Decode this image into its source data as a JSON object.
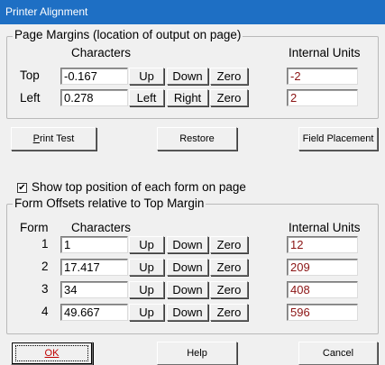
{
  "window": {
    "title": "Printer Alignment"
  },
  "page_margins": {
    "legend": "Page Margins (location of output on page)",
    "characters_header": "Characters",
    "internal_units_header": "Internal Units",
    "rows": [
      {
        "label": "Top",
        "characters": "-0.167",
        "btn1": "Up",
        "btn2": "Down",
        "btn3": "Zero",
        "internal": "-2"
      },
      {
        "label": "Left",
        "characters": "0.278",
        "btn1": "Left",
        "btn2": "Right",
        "btn3": "Zero",
        "internal": "2"
      }
    ]
  },
  "actions": {
    "print_test": "Print Test",
    "print_test_mnemonic": "P",
    "print_test_rest": "rint Test",
    "restore": "Restore",
    "field_placement": "Field Placement"
  },
  "show_top": {
    "label": "Show top position of each form on page",
    "checked": true,
    "mark": "✔"
  },
  "form_offsets": {
    "legend": "Form Offsets relative to Top Margin",
    "form_header": "Form",
    "characters_header": "Characters",
    "internal_units_header": "Internal Units",
    "rows": [
      {
        "form": "1",
        "characters": "1",
        "btn1": "Up",
        "btn2": "Down",
        "btn3": "Zero",
        "internal": "12"
      },
      {
        "form": "2",
        "characters": "17.417",
        "btn1": "Up",
        "btn2": "Down",
        "btn3": "Zero",
        "internal": "209"
      },
      {
        "form": "3",
        "characters": "34",
        "btn1": "Up",
        "btn2": "Down",
        "btn3": "Zero",
        "internal": "408"
      },
      {
        "form": "4",
        "characters": "49.667",
        "btn1": "Up",
        "btn2": "Down",
        "btn3": "Zero",
        "internal": "596"
      }
    ]
  },
  "footer": {
    "ok": "OK",
    "help": "Help",
    "cancel": "Cancel"
  },
  "colors": {
    "titlebar": "#1e6fc4",
    "internal_text": "#8b1414",
    "ok_text": "#c00000"
  }
}
